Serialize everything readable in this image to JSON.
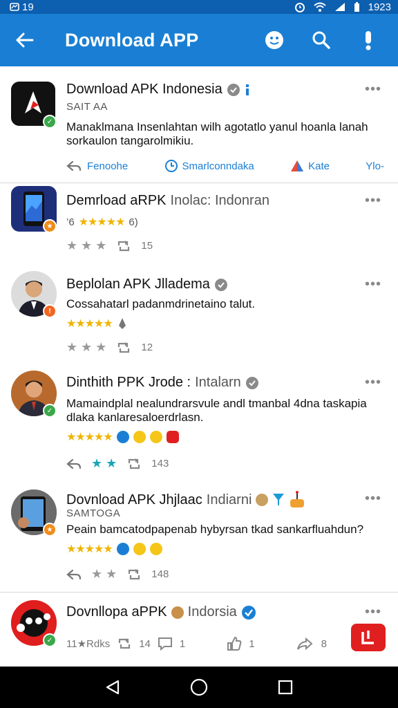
{
  "status_bar": {
    "time_left": "19",
    "time_right": "1923"
  },
  "app_bar": {
    "title": "Download APP"
  },
  "colors": {
    "primary": "#1a7fd4",
    "status_bar": "#0d5fb0",
    "star": "#f0b400",
    "badge_green": "#3aa84a",
    "badge_orange": "#f08c1a",
    "fab_red": "#e02020"
  },
  "posts": [
    {
      "title": "Download APK Indonesia",
      "handle": "SAIT AA",
      "description": "Manaklmana Insenlahtan wilh agotatlo yanul hoanla lanah sorkaulon tangarolmikiu.",
      "actions": [
        "Fenoohe",
        "Smarlconndaka",
        "Kate",
        "Ylo-"
      ]
    },
    {
      "title": "Demrload aRPK",
      "title_sub": "Inolac: Indonran",
      "rating_text": "’6",
      "rating_value": "6)",
      "stars": "★★★★★",
      "share_count": "15"
    },
    {
      "title": "Beplolan APK Jlladema",
      "description": "Cossahatarl padanmdrinetaino talut.",
      "stars": "★★★★★",
      "share_count": "12"
    },
    {
      "title": "Dinthith PPK Jrode :",
      "title_sub": "Intalarn",
      "description": "Mamaindplal nealundrarsvule andl tmanbal 4dna taskapia dlaka kanlaresaloerdrlasn.",
      "stars": "★★★★★",
      "share_count": "143"
    },
    {
      "title": "Dovnload APK Jhjlaac",
      "title_sub": "Indiarni",
      "handle": "SAMTOGA",
      "description": "Peain bamcatodpapenab hybyrsan tkad sankarfluahdun?",
      "stars": "★★★★★",
      "share_count": "148"
    },
    {
      "title": "Dovnllopa aPPK",
      "title_sub": "Indorsia",
      "likes_text": "11★Rdks",
      "count_a": "14",
      "count_b": "1",
      "count_c": "1",
      "count_d": "8"
    }
  ]
}
